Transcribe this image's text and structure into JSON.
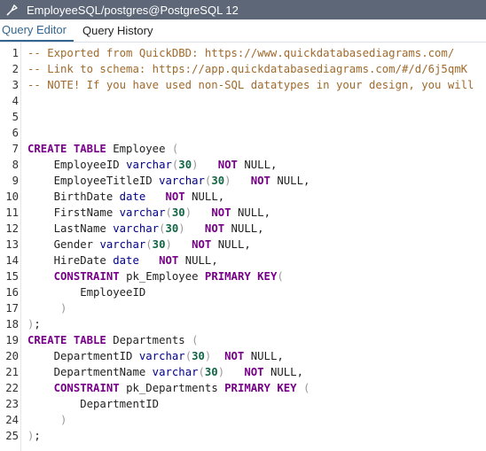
{
  "window": {
    "title": "EmployeeSQL/postgres@PostgreSQL 12"
  },
  "tabs": [
    {
      "label": "Query Editor",
      "active": true
    },
    {
      "label": "Query History",
      "active": false
    }
  ],
  "editor": {
    "line_numbers": [
      "1",
      "2",
      "3",
      "4",
      "5",
      "6",
      "7",
      "8",
      "9",
      "10",
      "11",
      "12",
      "13",
      "14",
      "15",
      "16",
      "17",
      "18",
      "19",
      "20",
      "21",
      "22",
      "23",
      "24",
      "25"
    ],
    "lines": [
      [
        {
          "t": "cm",
          "v": "-- Exported from QuickDBD: https://www.quickdatabasediagrams.com/"
        }
      ],
      [
        {
          "t": "cm",
          "v": "-- Link to schema: https://app.quickdatabasediagrams.com/#/d/6j5qmK"
        }
      ],
      [
        {
          "t": "cm",
          "v": "-- NOTE! If you have used non-SQL datatypes in your design, you will"
        }
      ],
      [],
      [],
      [],
      [
        {
          "t": "kw",
          "v": "CREATE TABLE"
        },
        {
          "t": "tx",
          "v": " Employee "
        },
        {
          "t": "pn",
          "v": "("
        }
      ],
      [
        {
          "t": "tx",
          "v": "    EmployeeID "
        },
        {
          "t": "ty",
          "v": "varchar"
        },
        {
          "t": "pn",
          "v": "("
        },
        {
          "t": "nb",
          "v": "30"
        },
        {
          "t": "pn",
          "v": ")"
        },
        {
          "t": "tx",
          "v": "   "
        },
        {
          "t": "kw",
          "v": "NOT"
        },
        {
          "t": "tx",
          "v": " NULL,"
        }
      ],
      [
        {
          "t": "tx",
          "v": "    EmployeeTitleID "
        },
        {
          "t": "ty",
          "v": "varchar"
        },
        {
          "t": "pn",
          "v": "("
        },
        {
          "t": "nb",
          "v": "30"
        },
        {
          "t": "pn",
          "v": ")"
        },
        {
          "t": "tx",
          "v": "   "
        },
        {
          "t": "kw",
          "v": "NOT"
        },
        {
          "t": "tx",
          "v": " NULL,"
        }
      ],
      [
        {
          "t": "tx",
          "v": "    BirthDate "
        },
        {
          "t": "ty",
          "v": "date"
        },
        {
          "t": "tx",
          "v": "   "
        },
        {
          "t": "kw",
          "v": "NOT"
        },
        {
          "t": "tx",
          "v": " NULL,"
        }
      ],
      [
        {
          "t": "tx",
          "v": "    FirstName "
        },
        {
          "t": "ty",
          "v": "varchar"
        },
        {
          "t": "pn",
          "v": "("
        },
        {
          "t": "nb",
          "v": "30"
        },
        {
          "t": "pn",
          "v": ")"
        },
        {
          "t": "tx",
          "v": "   "
        },
        {
          "t": "kw",
          "v": "NOT"
        },
        {
          "t": "tx",
          "v": " NULL,"
        }
      ],
      [
        {
          "t": "tx",
          "v": "    LastName "
        },
        {
          "t": "ty",
          "v": "varchar"
        },
        {
          "t": "pn",
          "v": "("
        },
        {
          "t": "nb",
          "v": "30"
        },
        {
          "t": "pn",
          "v": ")"
        },
        {
          "t": "tx",
          "v": "   "
        },
        {
          "t": "kw",
          "v": "NOT"
        },
        {
          "t": "tx",
          "v": " NULL,"
        }
      ],
      [
        {
          "t": "tx",
          "v": "    Gender "
        },
        {
          "t": "ty",
          "v": "varchar"
        },
        {
          "t": "pn",
          "v": "("
        },
        {
          "t": "nb",
          "v": "30"
        },
        {
          "t": "pn",
          "v": ")"
        },
        {
          "t": "tx",
          "v": "   "
        },
        {
          "t": "kw",
          "v": "NOT"
        },
        {
          "t": "tx",
          "v": " NULL,"
        }
      ],
      [
        {
          "t": "tx",
          "v": "    HireDate "
        },
        {
          "t": "ty",
          "v": "date"
        },
        {
          "t": "tx",
          "v": "   "
        },
        {
          "t": "kw",
          "v": "NOT"
        },
        {
          "t": "tx",
          "v": " NULL,"
        }
      ],
      [
        {
          "t": "tx",
          "v": "    "
        },
        {
          "t": "kw",
          "v": "CONSTRAINT"
        },
        {
          "t": "tx",
          "v": " pk_Employee "
        },
        {
          "t": "kw",
          "v": "PRIMARY KEY"
        },
        {
          "t": "pn",
          "v": "("
        }
      ],
      [
        {
          "t": "tx",
          "v": "        EmployeeID"
        }
      ],
      [
        {
          "t": "tx",
          "v": "     "
        },
        {
          "t": "pn",
          "v": ")"
        }
      ],
      [
        {
          "t": "pn",
          "v": ")"
        },
        {
          "t": "tx",
          "v": ";"
        }
      ],
      [
        {
          "t": "kw",
          "v": "CREATE TABLE"
        },
        {
          "t": "tx",
          "v": " Departments "
        },
        {
          "t": "pn",
          "v": "("
        }
      ],
      [
        {
          "t": "tx",
          "v": "    DepartmentID "
        },
        {
          "t": "ty",
          "v": "varchar"
        },
        {
          "t": "pn",
          "v": "("
        },
        {
          "t": "nb",
          "v": "30"
        },
        {
          "t": "pn",
          "v": ")"
        },
        {
          "t": "tx",
          "v": "  "
        },
        {
          "t": "kw",
          "v": "NOT"
        },
        {
          "t": "tx",
          "v": " NULL,"
        }
      ],
      [
        {
          "t": "tx",
          "v": "    DepartmentName "
        },
        {
          "t": "ty",
          "v": "varchar"
        },
        {
          "t": "pn",
          "v": "("
        },
        {
          "t": "nb",
          "v": "30"
        },
        {
          "t": "pn",
          "v": ")"
        },
        {
          "t": "tx",
          "v": "   "
        },
        {
          "t": "kw",
          "v": "NOT"
        },
        {
          "t": "tx",
          "v": " NULL,"
        }
      ],
      [
        {
          "t": "tx",
          "v": "    "
        },
        {
          "t": "kw",
          "v": "CONSTRAINT"
        },
        {
          "t": "tx",
          "v": " pk_Departments "
        },
        {
          "t": "kw",
          "v": "PRIMARY KEY"
        },
        {
          "t": "tx",
          "v": " "
        },
        {
          "t": "pn",
          "v": "("
        }
      ],
      [
        {
          "t": "tx",
          "v": "        DepartmentID"
        }
      ],
      [
        {
          "t": "tx",
          "v": "     "
        },
        {
          "t": "pn",
          "v": ")"
        }
      ],
      [
        {
          "t": "pn",
          "v": ")"
        },
        {
          "t": "tx",
          "v": ";"
        }
      ]
    ]
  },
  "colors": {
    "titlebar_bg": "#5e6778",
    "active_tab": "#326690",
    "comment": "#a06a2c",
    "keyword": "#770088",
    "type": "#000088",
    "number": "#116644"
  }
}
